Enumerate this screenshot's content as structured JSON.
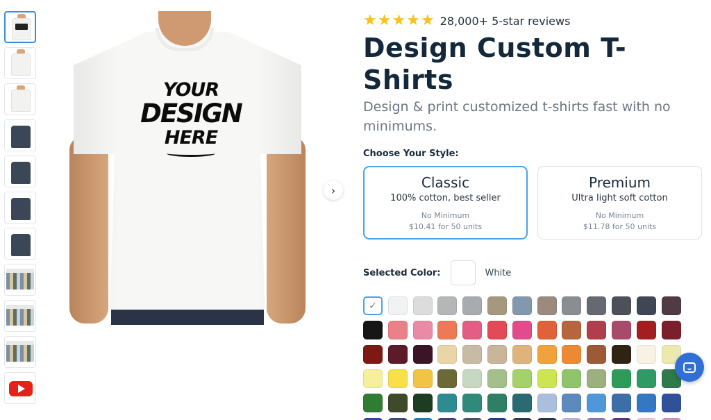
{
  "thumbnails": [
    {
      "name": "thumb-front-design",
      "kind": "design"
    },
    {
      "name": "thumb-front",
      "kind": "front"
    },
    {
      "name": "thumb-side",
      "kind": "side"
    },
    {
      "name": "thumb-back-navy",
      "kind": "navy"
    },
    {
      "name": "thumb-flat-navy",
      "kind": "flat"
    },
    {
      "name": "thumb-folded-navy",
      "kind": "folded"
    },
    {
      "name": "thumb-sleeve-navy",
      "kind": "sleeve"
    },
    {
      "name": "thumb-photo-1",
      "kind": "photo"
    },
    {
      "name": "thumb-photo-2",
      "kind": "photo"
    },
    {
      "name": "thumb-photo-3",
      "kind": "photo"
    },
    {
      "name": "thumb-video",
      "kind": "video"
    }
  ],
  "main_image": {
    "design_lines": [
      "YOUR",
      "DESIGN",
      "HERE"
    ]
  },
  "reviews": {
    "stars": 5,
    "text": "28,000+ 5-star reviews"
  },
  "product": {
    "title": "Design Custom T-Shirts",
    "subtitle": "Design & print customized t-shirts fast with no minimums."
  },
  "style_section": {
    "label": "Choose Your Style:",
    "options": [
      {
        "name": "Classic",
        "description": "100% cotton, best seller",
        "minimum": "No Minimum",
        "price": "$10.41 for 50 units",
        "selected": true
      },
      {
        "name": "Premium",
        "description": "Ultra light soft cotton",
        "minimum": "No Minimum",
        "price": "$11.78 for 50 units",
        "selected": false
      }
    ]
  },
  "color_section": {
    "label": "Selected Color:",
    "selected_name": "White",
    "selected_hex": "#ffffff",
    "selected_index": 0,
    "check_mark": "✓",
    "swatches": [
      "#ffffff",
      "#f1f2f3",
      "#dcdcdc",
      "#b4b6b8",
      "#a8abb0",
      "#a6987f",
      "#8298ad",
      "#9a8b7e",
      "#8b8e91",
      "#656a72",
      "#4c5058",
      "#414656",
      "#503a43",
      "#161616",
      "#ea8088",
      "#ea8aa6",
      "#ec7a56",
      "#e25f83",
      "#e34a57",
      "#e34c8c",
      "#e1613a",
      "#b6663f",
      "#b03f4b",
      "#a84a6a",
      "#a31f1f",
      "#7b1f2d",
      "#7d1812",
      "#5d1a2b",
      "#3c1427",
      "#ead5a6",
      "#c8bba3",
      "#c9b59a",
      "#dfb37c",
      "#f0a33d",
      "#ec8a34",
      "#9c5b35",
      "#2f2316",
      "#f7f2e4",
      "#ece9ae",
      "#f6ef9c",
      "#f8e04b",
      "#f2c443",
      "#6b6a36",
      "#c6d8c1",
      "#a5bf8b",
      "#a4d16a",
      "#cde552",
      "#8ec56a",
      "#9bb07c",
      "#2d9b59",
      "#2f9a64",
      "#2e7a4a",
      "#2f7c33",
      "#3f4a2a",
      "#1d3d22",
      "#2f8b92",
      "#2f8a7c",
      "#2f7f66",
      "#2a6a71",
      "#a9bfdb",
      "#5d89bd",
      "#4f97d8",
      "#3c6fa8",
      "#3478c3",
      "#30519a",
      "#344aa0",
      "#3f4b86",
      "#2f7db4",
      "#4b3f86",
      "#46566a",
      "#1e3da0",
      "#2e3a55",
      "#2a3550",
      "#c1b6e3",
      "#8b7bb8",
      "#612f93",
      "#efc6d8",
      "#e08ec6"
    ]
  },
  "accent_colors": {
    "selected_border": "#4aa3e6",
    "star": "#f7c21b",
    "title": "#13283b",
    "chat": "#2f6fd6"
  },
  "icons": {
    "next_arrow": "›",
    "star": "★"
  }
}
